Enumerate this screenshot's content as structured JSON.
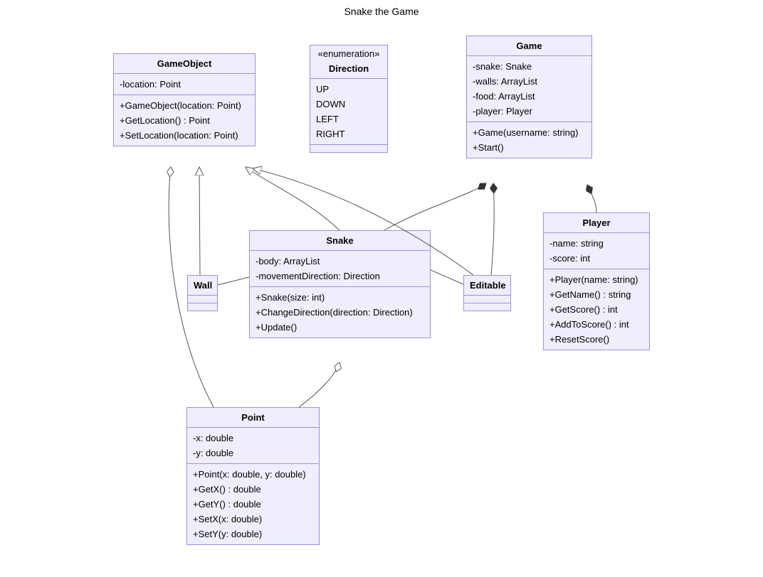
{
  "title": "Snake the Game",
  "classes": {
    "gameObject": {
      "name": "GameObject",
      "attrs": [
        "-location: Point"
      ],
      "ops": [
        "+GameObject(location: Point)",
        "+GetLocation() : Point",
        "+SetLocation(location: Point)"
      ]
    },
    "direction": {
      "stereotype": "«enumeration»",
      "name": "Direction",
      "literals": [
        "UP",
        "DOWN",
        "LEFT",
        "RIGHT"
      ]
    },
    "game": {
      "name": "Game",
      "attrs": [
        "-snake: Snake",
        "-walls: ArrayList",
        "-food: ArrayList",
        "-player: Player"
      ],
      "ops": [
        "+Game(username: string)",
        "+Start()"
      ]
    },
    "wall": {
      "name": "Wall"
    },
    "snake": {
      "name": "Snake",
      "attrs": [
        "-body: ArrayList",
        "-movementDirection: Direction"
      ],
      "ops": [
        "+Snake(size: int)",
        "+ChangeDirection(direction: Direction)",
        "+Update()"
      ]
    },
    "editable": {
      "name": "Editable"
    },
    "player": {
      "name": "Player",
      "attrs": [
        "-name: string",
        "-score: int"
      ],
      "ops": [
        "+Player(name: string)",
        "+GetName() : string",
        "+GetScore() : int",
        "+AddToScore() : int",
        "+ResetScore()"
      ]
    },
    "point": {
      "name": "Point",
      "attrs": [
        "-x: double",
        "-y: double"
      ],
      "ops": [
        "+Point(x: double, y: double)",
        "+GetX() : double",
        "+GetY() : double",
        "+SetX(x: double)",
        "+SetY(y: double)"
      ]
    }
  },
  "chart_data": {
    "type": "uml-class-diagram",
    "title": "Snake the Game",
    "classes": [
      {
        "id": "GameObject",
        "kind": "class",
        "attributes": [
          "-location: Point"
        ],
        "operations": [
          "+GameObject(location: Point)",
          "+GetLocation() : Point",
          "+SetLocation(location: Point)"
        ]
      },
      {
        "id": "Direction",
        "kind": "enumeration",
        "literals": [
          "UP",
          "DOWN",
          "LEFT",
          "RIGHT"
        ]
      },
      {
        "id": "Game",
        "kind": "class",
        "attributes": [
          "-snake: Snake",
          "-walls: ArrayList",
          "-food: ArrayList",
          "-player: Player"
        ],
        "operations": [
          "+Game(username: string)",
          "+Start()"
        ]
      },
      {
        "id": "Wall",
        "kind": "class"
      },
      {
        "id": "Snake",
        "kind": "class",
        "attributes": [
          "-body: ArrayList",
          "-movementDirection: Direction"
        ],
        "operations": [
          "+Snake(size: int)",
          "+ChangeDirection(direction: Direction)",
          "+Update()"
        ]
      },
      {
        "id": "Editable",
        "kind": "class"
      },
      {
        "id": "Player",
        "kind": "class",
        "attributes": [
          "-name: string",
          "-score: int"
        ],
        "operations": [
          "+Player(name: string)",
          "+GetName() : string",
          "+GetScore() : int",
          "+AddToScore() : int",
          "+ResetScore()"
        ]
      },
      {
        "id": "Point",
        "kind": "class",
        "attributes": [
          "-x: double",
          "-y: double"
        ],
        "operations": [
          "+Point(x: double, y: double)",
          "+GetX() : double",
          "+GetY() : double",
          "+SetX(x: double)",
          "+SetY(y: double)"
        ]
      }
    ],
    "relationships": [
      {
        "from": "Wall",
        "to": "GameObject",
        "type": "generalization"
      },
      {
        "from": "Snake",
        "to": "GameObject",
        "type": "generalization"
      },
      {
        "from": "Editable",
        "to": "GameObject",
        "type": "generalization"
      },
      {
        "from": "Point",
        "to": "GameObject",
        "type": "aggregation",
        "aggregateEnd": "GameObject"
      },
      {
        "from": "Point",
        "to": "Snake",
        "type": "aggregation",
        "aggregateEnd": "Snake"
      },
      {
        "from": "Wall",
        "to": "Snake",
        "type": "association"
      },
      {
        "from": "Snake",
        "to": "Editable",
        "type": "association"
      },
      {
        "from": "Snake",
        "to": "Game",
        "type": "composition",
        "wholeEnd": "Game"
      },
      {
        "from": "Editable",
        "to": "Game",
        "type": "composition",
        "wholeEnd": "Game"
      },
      {
        "from": "Player",
        "to": "Game",
        "type": "composition",
        "wholeEnd": "Game"
      }
    ]
  }
}
